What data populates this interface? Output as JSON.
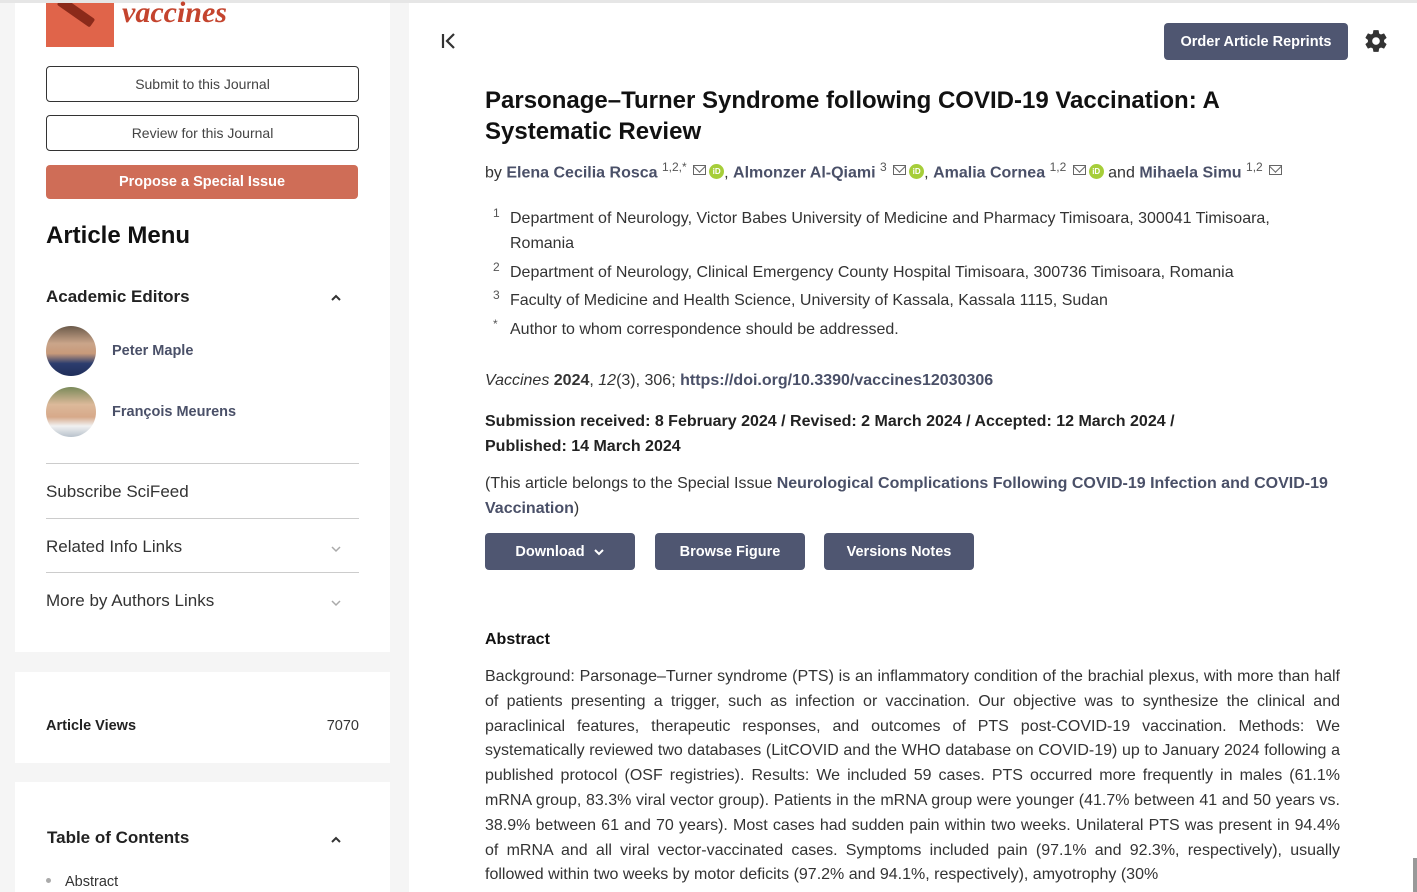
{
  "journal": {
    "logo_text": "vaccines"
  },
  "sidebar": {
    "submit_label": "Submit to this Journal",
    "review_label": "Review for this Journal",
    "propose_label": "Propose a Special Issue",
    "menu_title": "Article Menu",
    "academic_editors_title": "Academic Editors",
    "editors": [
      {
        "name": "Peter Maple"
      },
      {
        "name": "François Meurens"
      }
    ],
    "links": [
      {
        "label": "Subscribe SciFeed"
      },
      {
        "label": "Related Info Links"
      },
      {
        "label": "More by Authors Links"
      }
    ],
    "views_label": "Article Views",
    "views_count": "7070",
    "toc_title": "Table of Contents",
    "toc_items": [
      {
        "label": "Abstract"
      }
    ]
  },
  "header": {
    "reprints_label": "Order Article Reprints"
  },
  "article": {
    "title": "Parsonage–Turner Syndrome following COVID-19 Vaccination: A Systematic Review",
    "by": "by",
    "authors": [
      {
        "name": "Elena Cecilia Rosca",
        "sup": "1,2,*"
      },
      {
        "name": "Almonzer Al-Qiami",
        "sup": "3"
      },
      {
        "name": "Amalia Cornea",
        "sup": "1,2"
      },
      {
        "name": "Mihaela Simu",
        "sup": "1,2"
      }
    ],
    "and": "and",
    "affiliations": [
      {
        "num": "1",
        "text": "Department of Neurology, Victor Babes University of Medicine and Pharmacy Timisoara, 300041 Timisoara, Romania"
      },
      {
        "num": "2",
        "text": "Department of Neurology, Clinical Emergency County Hospital Timisoara, 300736 Timisoara, Romania"
      },
      {
        "num": "3",
        "text": "Faculty of Medicine and Health Science, University of Kassala, Kassala 1115, Sudan"
      },
      {
        "num": "*",
        "text": "Author to whom correspondence should be addressed."
      }
    ],
    "citation": {
      "journal": "Vaccines",
      "year": "2024",
      "volume": "12",
      "issue_pages": "(3), 306;",
      "doi": "https://doi.org/10.3390/vaccines12030306"
    },
    "dates": "Submission received: 8 February 2024 / Revised: 2 March 2024 / Accepted: 12 March 2024 / Published: 14 March 2024",
    "special_issue": {
      "prefix": "(This article belongs to the Special Issue ",
      "link": "Neurological Complications Following COVID-19 Infection and COVID-19 Vaccination",
      "suffix": ")"
    },
    "buttons": {
      "download": "Download",
      "browse_figure": "Browse Figure",
      "versions_notes": "Versions Notes"
    },
    "abstract_heading": "Abstract",
    "abstract_text": "Background: Parsonage–Turner syndrome (PTS) is an inflammatory condition of the brachial plexus, with more than half of patients presenting a trigger, such as infection or vaccination. Our objective was to synthesize the clinical and paraclinical features, therapeutic responses, and outcomes of PTS post-COVID-19 vaccination. Methods: We systematically reviewed two databases (LitCOVID and the WHO database on COVID-19) up to January 2024 following a published protocol (OSF registries). Results: We included 59 cases. PTS occurred more frequently in males (61.1% mRNA group, 83.3% viral vector group). Patients in the mRNA group were younger (41.7% between 41 and 50 years vs. 38.9% between 61 and 70 years). Most cases had sudden pain within two weeks. Unilateral PTS was present in 94.4% of mRNA and all viral vector-vaccinated cases. Symptoms included pain (97.1% and 92.3%, respectively), usually followed within two weeks by motor deficits (97.2% and 94.1%, respectively), amyotrophy (30%"
  }
}
